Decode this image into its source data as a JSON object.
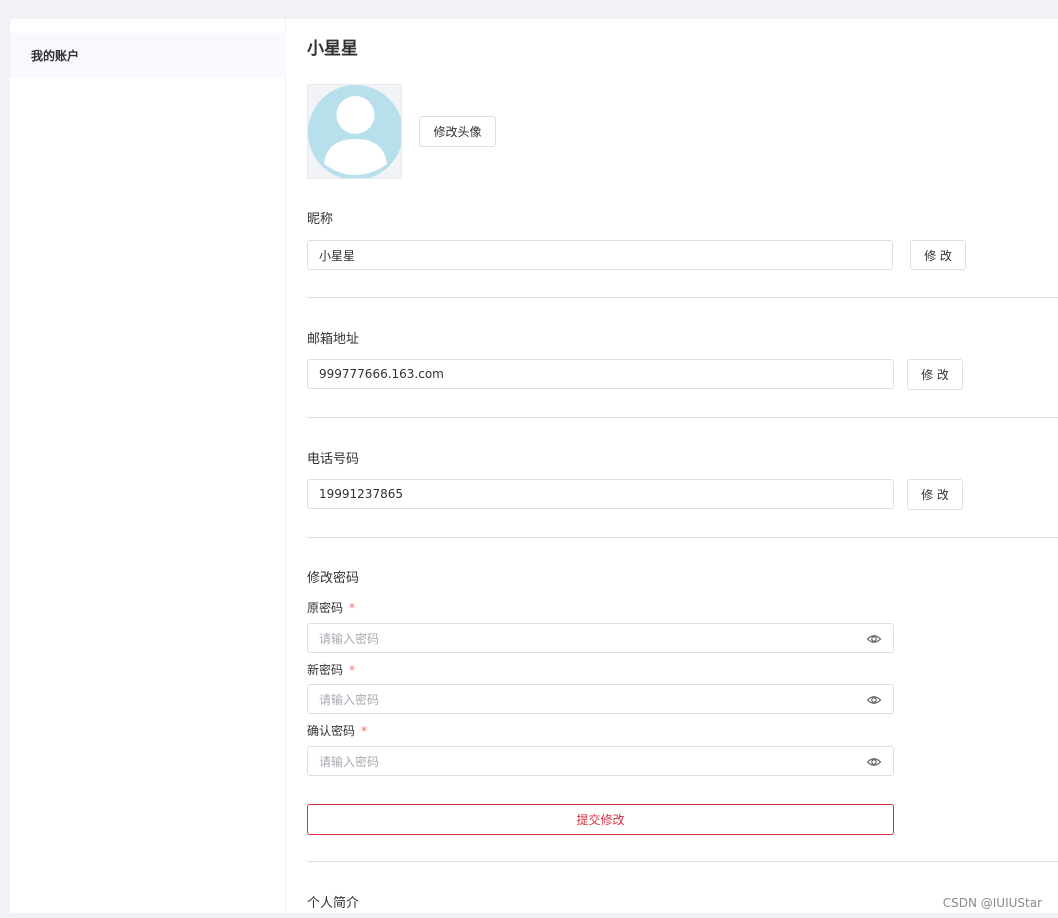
{
  "sidebar": {
    "items": [
      {
        "label": "我的账户"
      }
    ]
  },
  "profile": {
    "title": "小星星",
    "change_avatar_label": "修改头像"
  },
  "nickname": {
    "label": "昵称",
    "value": "小星星",
    "button": "修 改"
  },
  "email": {
    "label": "邮箱地址",
    "value": "999777666.163.com",
    "button": "修 改"
  },
  "phone": {
    "label": "电话号码",
    "value": "19991237865",
    "button": "修 改"
  },
  "password": {
    "section_label": "修改密码",
    "old_label": "原密码",
    "new_label": "新密码",
    "confirm_label": "确认密码",
    "required_mark": "*",
    "placeholder": "请输入密码",
    "submit_label": "提交修改"
  },
  "bio": {
    "label": "个人简介"
  },
  "watermark": "CSDN @IUIUStar",
  "colors": {
    "accent_red": "#d9303f",
    "avatar_icon": "#b8e0ec",
    "required": "#f56c6c"
  },
  "icons": [
    "user-avatar-icon",
    "eye-icon"
  ]
}
